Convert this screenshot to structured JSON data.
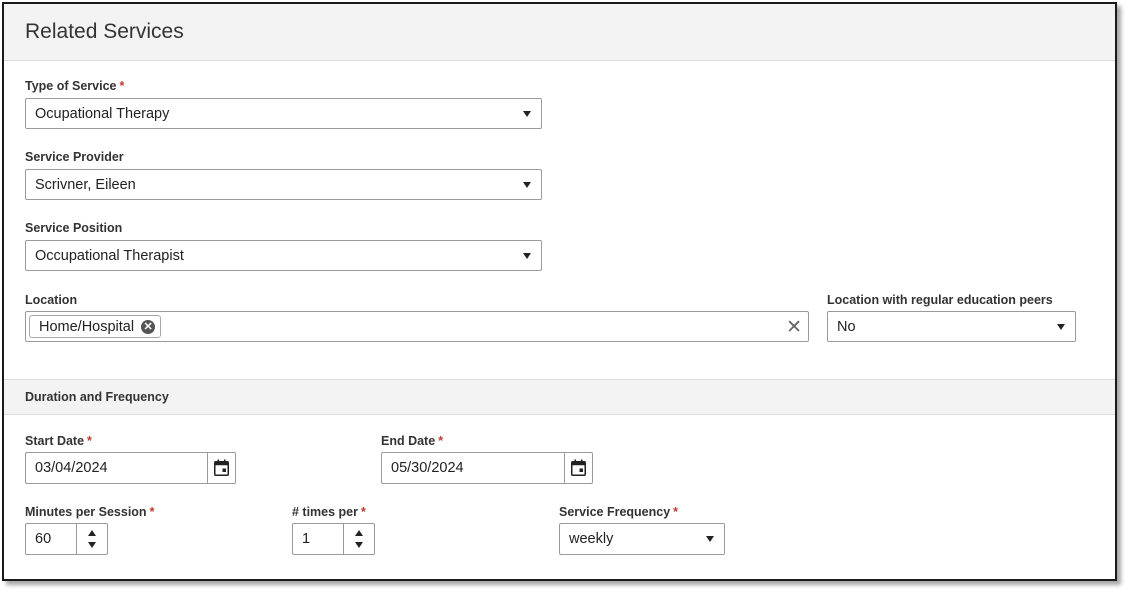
{
  "panel": {
    "title": "Related Services"
  },
  "type_of_service": {
    "label": "Type of Service",
    "required": "*",
    "value": "Ocupational Therapy"
  },
  "service_provider": {
    "label": "Service Provider",
    "value": "Scrivner, Eileen"
  },
  "service_position": {
    "label": "Service Position",
    "value": "Occupational Therapist"
  },
  "location": {
    "label": "Location",
    "tags": [
      "Home/Hospital"
    ]
  },
  "location_peers": {
    "label": "Location with regular education peers",
    "value": "No"
  },
  "duration_section": {
    "title": "Duration and Frequency"
  },
  "start_date": {
    "label": "Start Date",
    "required": "*",
    "value": "03/04/2024"
  },
  "end_date": {
    "label": "End Date",
    "required": "*",
    "value": "05/30/2024"
  },
  "minutes_per_session": {
    "label": "Minutes per Session",
    "required": "*",
    "value": "60"
  },
  "times_per": {
    "label": "# times per",
    "required": "*",
    "value": "1"
  },
  "service_frequency": {
    "label": "Service Frequency",
    "required": "*",
    "value": "weekly"
  },
  "colors": {
    "required": "#c0392b",
    "header_bg": "#f3f3f3"
  },
  "icons": [
    "dropdown-caret-icon",
    "remove-tag-icon",
    "clear-icon",
    "calendar-icon",
    "spin-up-icon",
    "spin-down-icon"
  ]
}
